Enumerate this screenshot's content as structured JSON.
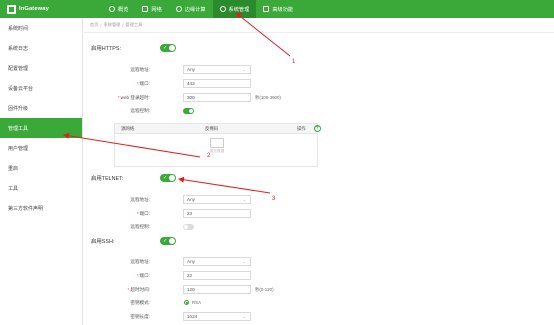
{
  "brand": {
    "name": "InGateway"
  },
  "nav": {
    "tabs": [
      {
        "label": "概览",
        "icon": "dashboard-icon"
      },
      {
        "label": "网络",
        "icon": "network-icon"
      },
      {
        "label": "边缘计算",
        "icon": "edge-computing-icon"
      },
      {
        "label": "系统管理",
        "icon": "gear-icon",
        "active": true
      },
      {
        "label": "高级功能",
        "icon": "grid-icon"
      }
    ]
  },
  "sidebar": {
    "items": [
      {
        "label": "系统时间"
      },
      {
        "label": "系统日志"
      },
      {
        "label": "配置管理"
      },
      {
        "label": "设备云平台"
      },
      {
        "label": "固件升级"
      },
      {
        "label": "管理工具",
        "active": true
      },
      {
        "label": "用户管理"
      },
      {
        "label": "重启"
      },
      {
        "label": "工具"
      },
      {
        "label": "第三方软件声明"
      }
    ]
  },
  "breadcrumb": {
    "items": [
      "首页",
      "系统管理",
      "管理工具"
    ]
  },
  "https": {
    "label": "启用HTTPS:",
    "enabled": true,
    "remote_addr_label": "远程地址:",
    "remote_addr_value": "Any",
    "port_label": "端口:",
    "port_value": "443",
    "timeout_label": "web 登录超时:",
    "timeout_value": "300",
    "timeout_hint": "秒(100-3600)",
    "remote_control_label": "远程控制:",
    "remote_control_on": true
  },
  "whitelist": {
    "columns": [
      "源网络",
      "反掩码",
      "操作"
    ],
    "empty_text": "暂无数据",
    "add_label": "+"
  },
  "telnet": {
    "label": "启用TELNET:",
    "enabled": true,
    "remote_addr_label": "远程地址:",
    "remote_addr_value": "Any",
    "port_label": "端口:",
    "port_value": "23",
    "remote_control_label": "远程控制:",
    "remote_control_on": false
  },
  "ssh": {
    "label": "启用SSH:",
    "enabled": true,
    "remote_addr_label": "远程地址:",
    "remote_addr_value": "Any",
    "port_label": "端口:",
    "port_value": "22",
    "timeout_label": "超时时间:",
    "timeout_value": "120",
    "timeout_hint": "秒(0-120)",
    "key_mode_label": "密钥模式:",
    "key_mode_value": "RSA",
    "key_length_label": "密钥长度:",
    "key_length_value": "1024"
  },
  "annotations": {
    "color": "#e02020",
    "labels": [
      "1",
      "2",
      "3"
    ]
  },
  "colors": {
    "accent": "#3aa93a",
    "accent_dark": "#2b8a2b"
  }
}
